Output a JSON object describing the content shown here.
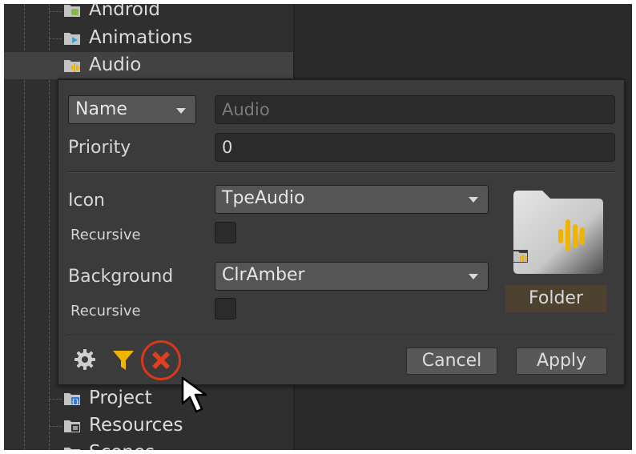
{
  "tree": {
    "items_above": [
      {
        "label": "Android",
        "icon": "android-folder-icon"
      },
      {
        "label": "Animations",
        "icon": "animations-folder-icon"
      },
      {
        "label": "Audio",
        "icon": "audio-folder-icon",
        "selected": true
      }
    ],
    "items_below": [
      {
        "label": "Project",
        "icon": "project-folder-icon"
      },
      {
        "label": "Resources",
        "icon": "resources-folder-icon"
      },
      {
        "label": "Scenes",
        "icon": "scenes-folder-icon"
      }
    ]
  },
  "popup": {
    "match_mode": "Name",
    "name_value": "Audio",
    "priority_label": "Priority",
    "priority_value": "0",
    "icon_label": "Icon",
    "icon_value": "TpeAudio",
    "icon_recursive_label": "Recursive",
    "background_label": "Background",
    "background_value": "ClrAmber",
    "background_recursive_label": "Recursive",
    "preview_label": "Folder",
    "cancel_label": "Cancel",
    "apply_label": "Apply"
  },
  "colors": {
    "accent_amber": "#f0b400",
    "delete_red": "#e0401f",
    "highlight_ring": "#d8381a"
  }
}
